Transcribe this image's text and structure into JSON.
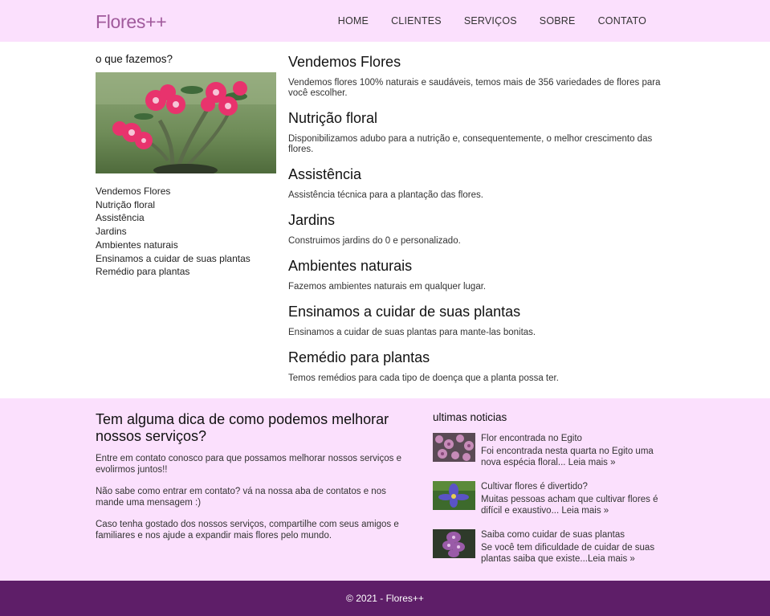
{
  "header": {
    "logo": "Flores++",
    "nav": [
      "HOME",
      "CLIENTES",
      "SERVIÇOS",
      "SOBRE",
      "CONTATO"
    ]
  },
  "sidebar": {
    "title": "o que fazemos?",
    "items": [
      "Vendemos Flores",
      "Nutrição floral",
      "Assistência",
      "Jardins",
      "Ambientes naturais",
      "Ensinamos a cuidar de suas plantas",
      "Remédio para plantas"
    ]
  },
  "services": [
    {
      "title": "Vendemos Flores",
      "text": "Vendemos flores 100% naturais e saudáveis, temos mais de 356 variedades de flores para você escolher."
    },
    {
      "title": "Nutrição floral",
      "text": "Disponibilizamos adubo para a nutrição e, consequentemente, o melhor crescimento das flores."
    },
    {
      "title": "Assistência",
      "text": "Assistência técnica para a plantação das flores."
    },
    {
      "title": "Jardins",
      "text": "Construimos jardins do 0 e personalizado."
    },
    {
      "title": "Ambientes naturais",
      "text": "Fazemos ambientes naturais em qualquer lugar."
    },
    {
      "title": "Ensinamos a cuidar de suas plantas",
      "text": "Ensinamos a cuidar de suas plantas para mante-las bonitas."
    },
    {
      "title": "Remédio para plantas",
      "text": "Temos remédios para cada tipo de doença que a planta possa ter."
    }
  ],
  "tip": {
    "title": "Tem alguma dica de como podemos melhorar nossos serviços?",
    "paragraphs": [
      "Entre em contato conosco para que possamos melhorar nossos serviços e evolirmos juntos!!",
      "Não sabe como entrar em contato? vá na nossa aba de contatos e nos mande uma mensagem :)",
      "Caso tenha gostado dos nossos serviços, compartilhe com seus amigos e familiares e nos ajude a expandir mais flores pelo mundo."
    ]
  },
  "news": {
    "title": "ultimas noticias",
    "items": [
      {
        "title": "Flor encontrada no Egito",
        "text": "Foi encontrada nesta quarta no Egito uma nova espécia floral... ",
        "link": "Leia mais »"
      },
      {
        "title": "Cultivar flores é divertido?",
        "text": "Muitas pessoas acham que cultivar flores é difícil e exaustivo... ",
        "link": "Leia mais »"
      },
      {
        "title": "Saiba como cuidar de suas plantas",
        "text": "Se você tem dificuldade de cuidar de suas plantas saiba que existe...",
        "link": "Leia mais »"
      }
    ]
  },
  "footer": {
    "copyright": "© 2021 - Flores++"
  },
  "colors": {
    "header_bg": "#fbe0fd",
    "logo": "#a05a9c",
    "footer_bg": "#5e1e68"
  }
}
